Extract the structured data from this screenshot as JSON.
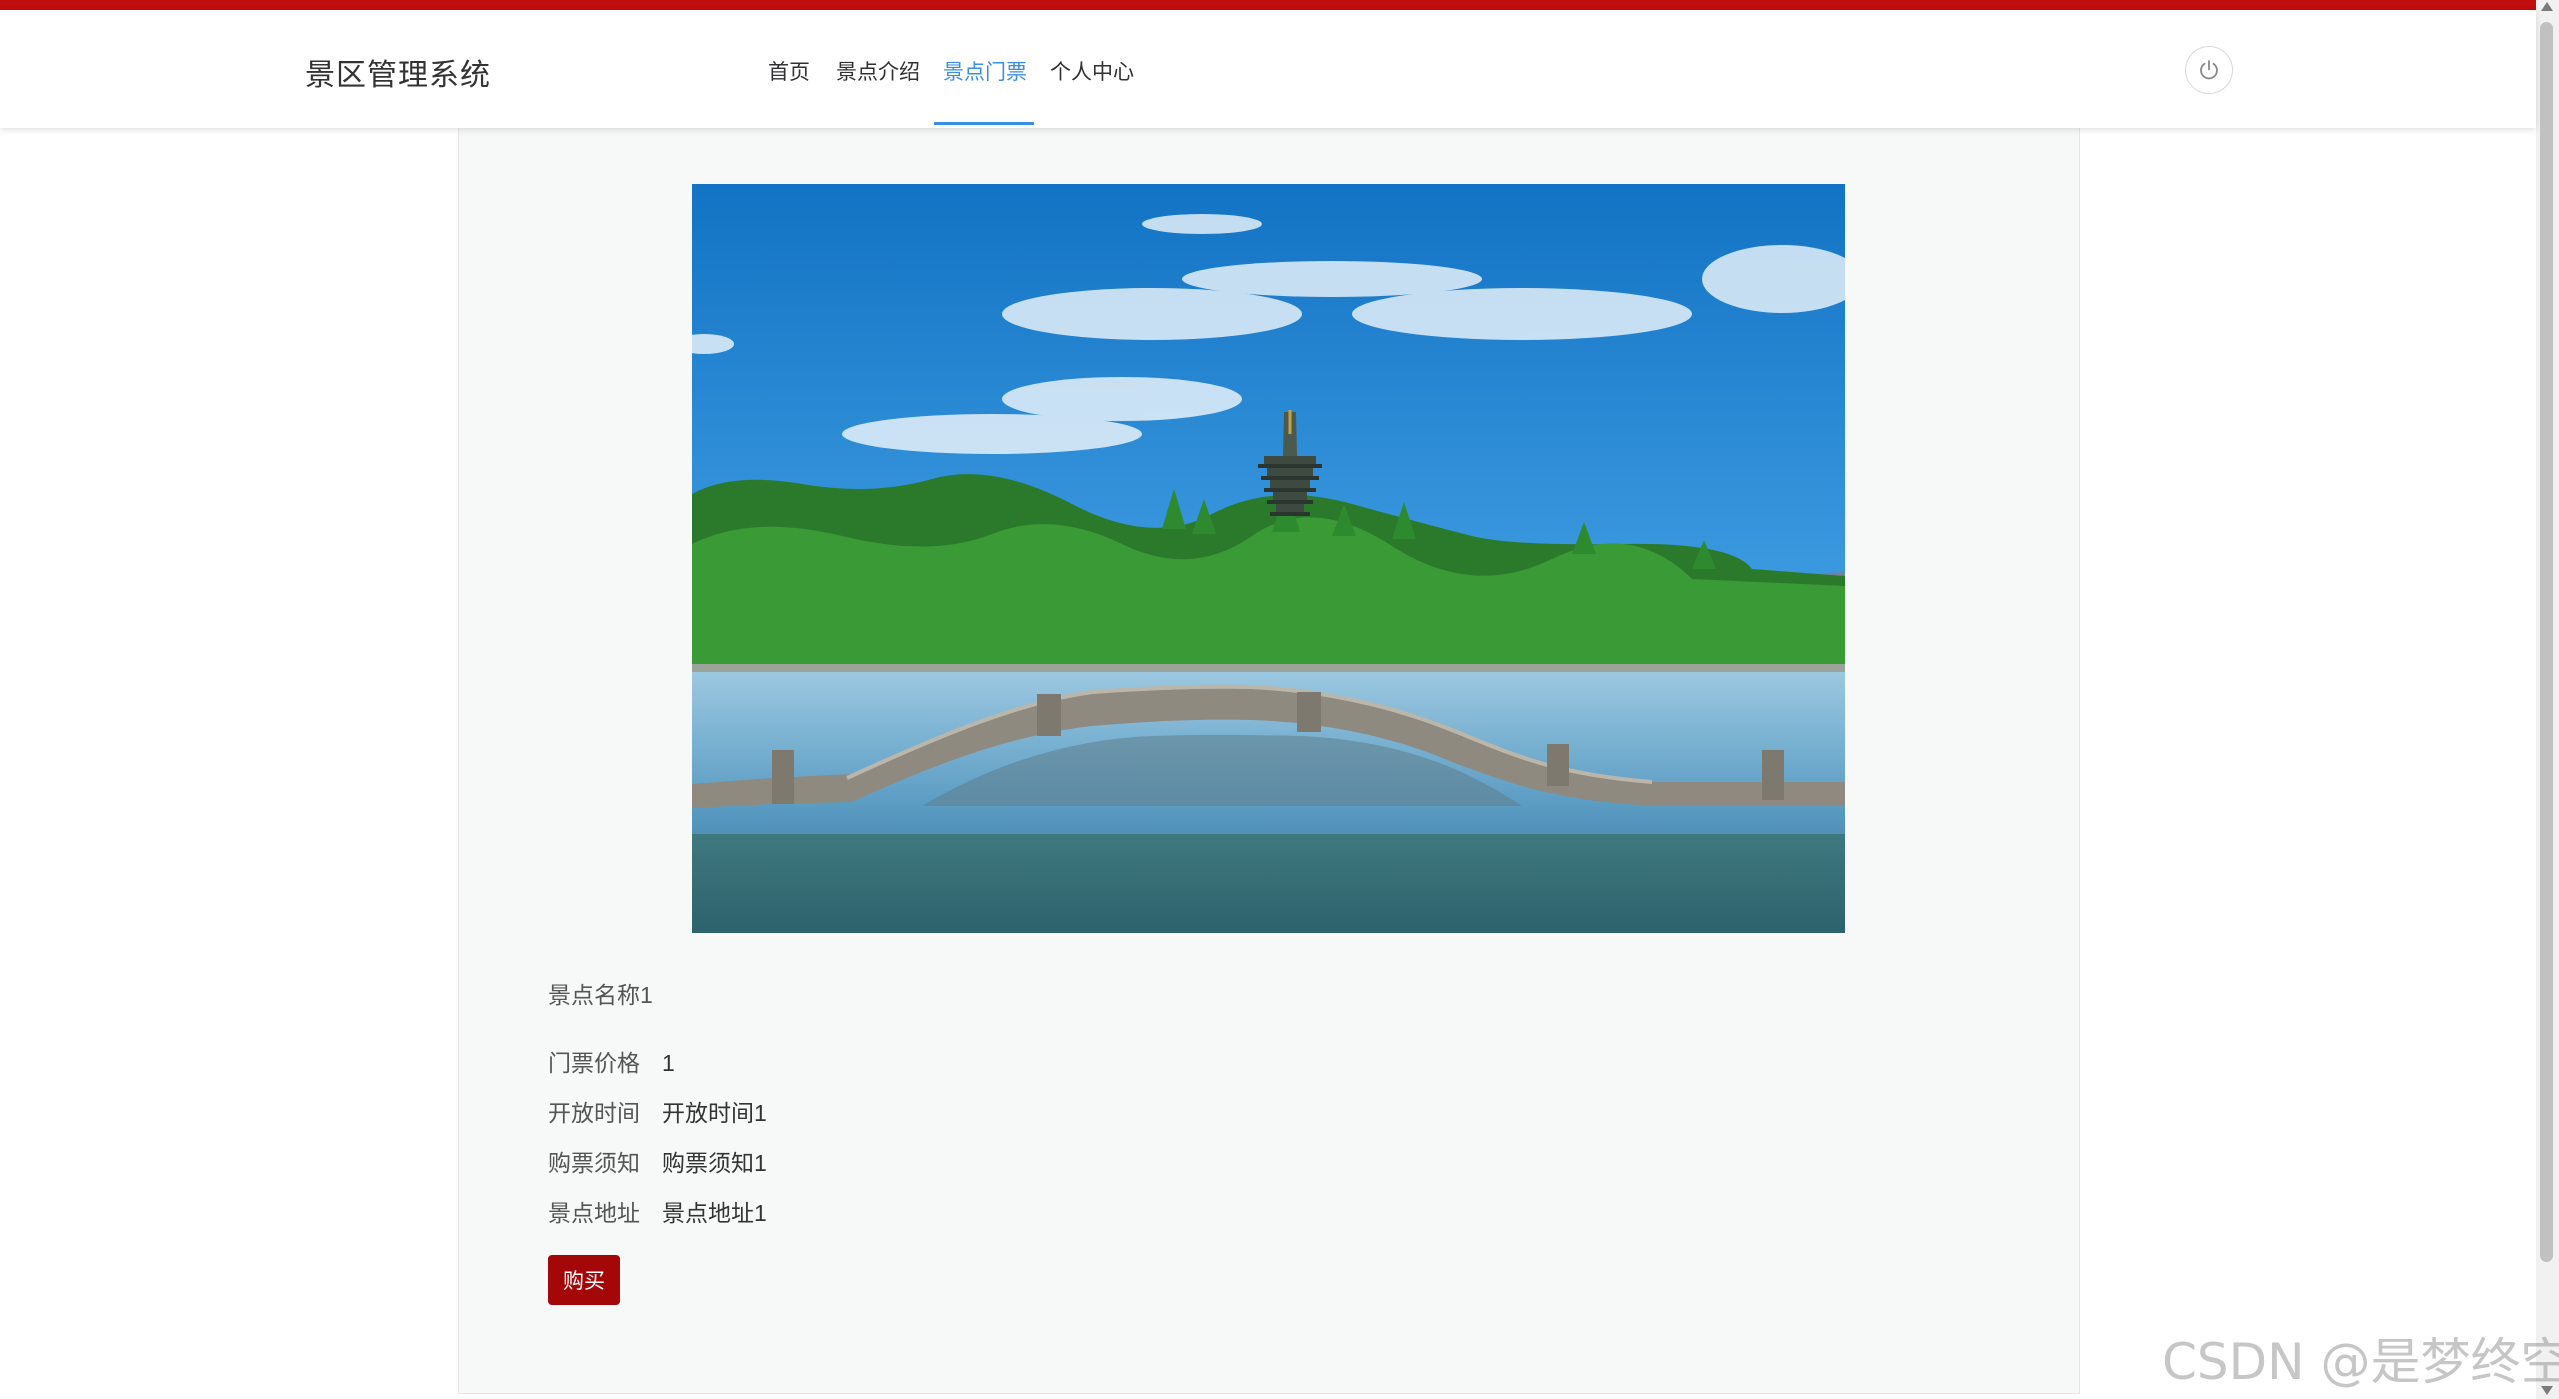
{
  "app": {
    "title": "景区管理系统"
  },
  "nav": {
    "items": [
      {
        "label": "首页"
      },
      {
        "label": "景点介绍"
      },
      {
        "label": "景点门票"
      },
      {
        "label": "个人中心"
      }
    ],
    "active_index": 2
  },
  "header": {
    "power_icon": "power-icon"
  },
  "spot": {
    "name": "景点名称1",
    "fields": [
      {
        "label": "门票价格",
        "value": "1"
      },
      {
        "label": "开放时间",
        "value": "开放时间1"
      },
      {
        "label": "购票须知",
        "value": "购票须知1"
      },
      {
        "label": "景点地址",
        "value": "景点地址1"
      }
    ]
  },
  "actions": {
    "buy_label": "购买"
  },
  "watermark": "CSDN @是梦终空",
  "colors": {
    "accent_red": "#c00d0d",
    "buy_button": "#a30707",
    "active_nav": "#3a8ee6",
    "panel_bg": "#f7f8f8"
  }
}
